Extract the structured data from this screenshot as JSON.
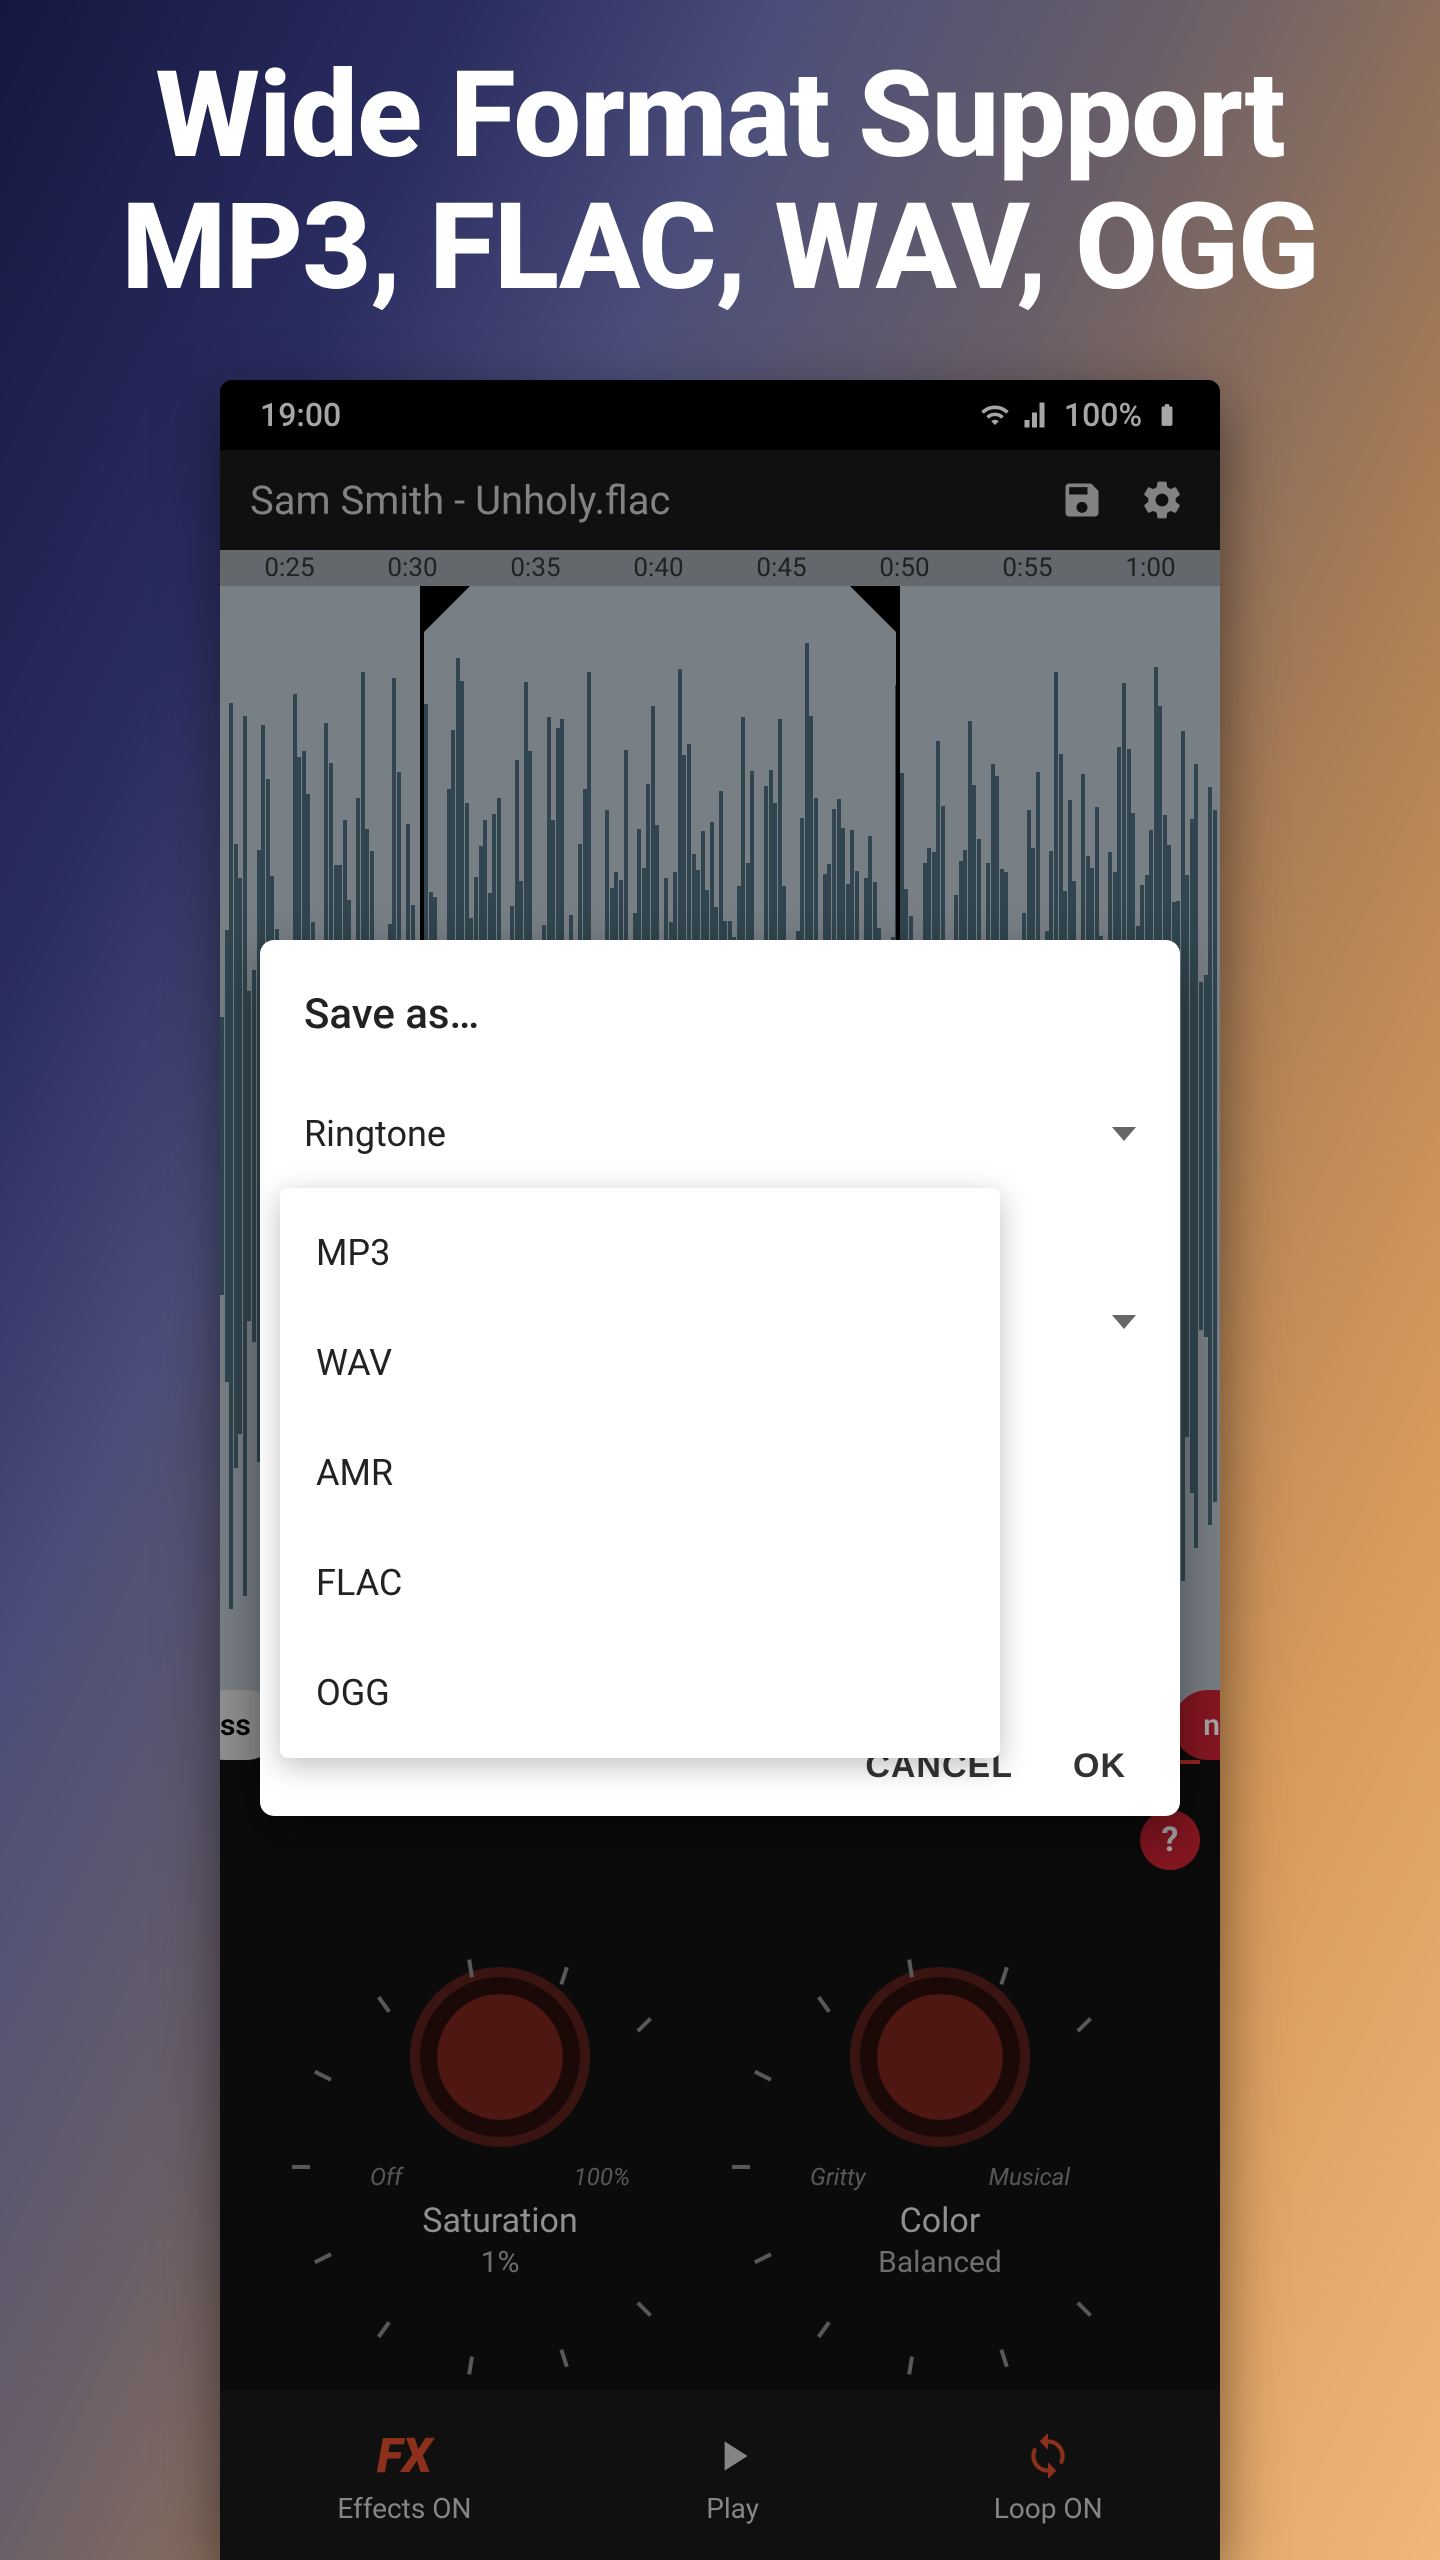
{
  "headline": {
    "line1": "Wide Format Support",
    "line2": "MP3, FLAC, WAV, OGG"
  },
  "statusbar": {
    "time": "19:00",
    "battery": "100%"
  },
  "header": {
    "filename": "Sam Smith - Unholy.flac"
  },
  "ruler": [
    "0:25",
    "0:30",
    "0:35",
    "0:40",
    "0:45",
    "0:50",
    "0:55",
    "1:00"
  ],
  "pills": {
    "left": "ss",
    "right": "n"
  },
  "dialog": {
    "title": "Save as…",
    "type_selected": "Ringtone",
    "format_options": [
      "MP3",
      "WAV",
      "AMR",
      "FLAC",
      "OGG"
    ],
    "cancel": "CANCEL",
    "ok": "OK"
  },
  "knobs": {
    "saturation": {
      "left": "Off",
      "right": "100%",
      "title": "Saturation",
      "value": "1%"
    },
    "color": {
      "left": "Gritty",
      "right": "Musical",
      "title": "Color",
      "value": "Balanced"
    }
  },
  "bottombar": {
    "fx": {
      "sym": "FX",
      "label": "Effects ON"
    },
    "play": {
      "label": "Play"
    },
    "loop": {
      "label": "Loop ON"
    }
  }
}
